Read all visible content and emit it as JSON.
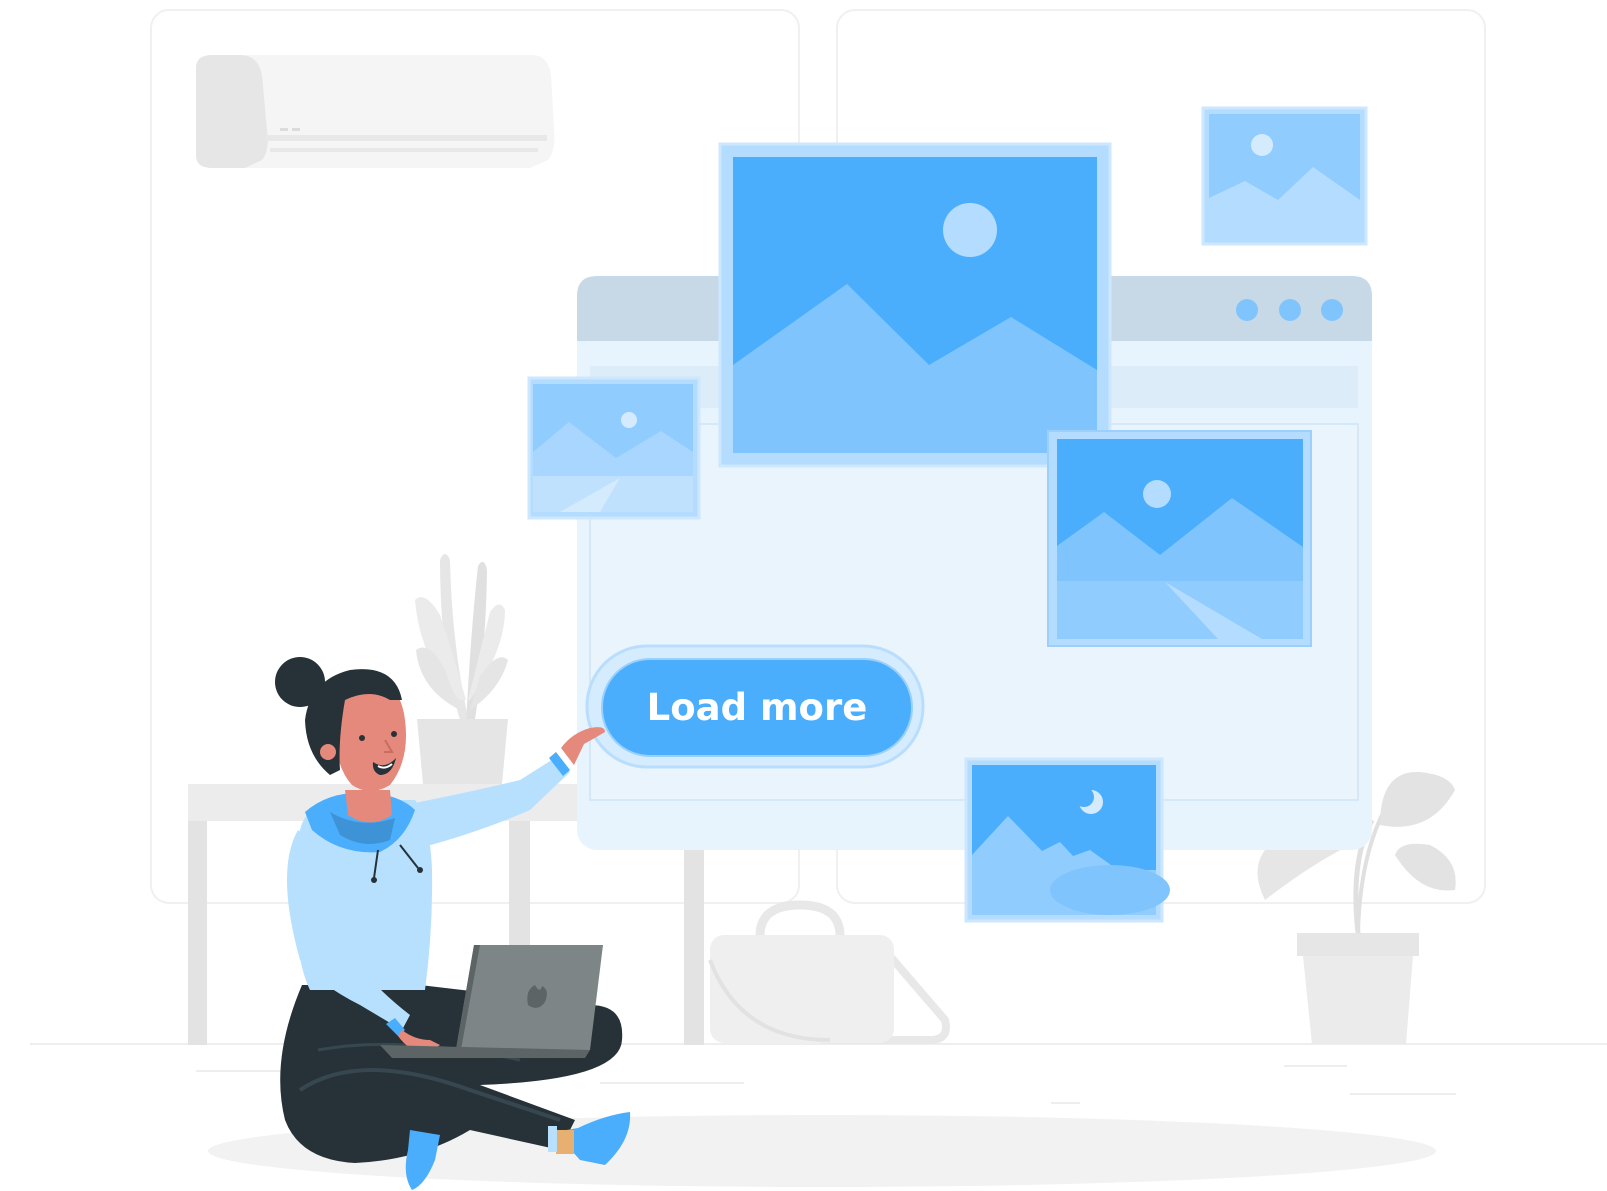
{
  "load_more": {
    "label": "Load more"
  },
  "colors": {
    "accent": "#4aaefc",
    "accent_light": "#80c4fd",
    "accent_pale": "#b4dcfe",
    "window_bg": "#e8f4fd",
    "window_chrome": "#c7d8e7",
    "neutral_light": "#ebebeb",
    "neutral_mid": "#e0e0e0",
    "skin": "#e4897b",
    "hair": "#263238",
    "hoodie": "#b7e0ff",
    "laptop": "#7d8587"
  },
  "icons": {
    "window_dots": [
      "dot-icon",
      "dot-icon",
      "dot-icon"
    ],
    "photos": [
      "image-placeholder-icon",
      "image-placeholder-icon",
      "image-placeholder-icon",
      "image-placeholder-icon",
      "night-image-placeholder-icon"
    ]
  }
}
